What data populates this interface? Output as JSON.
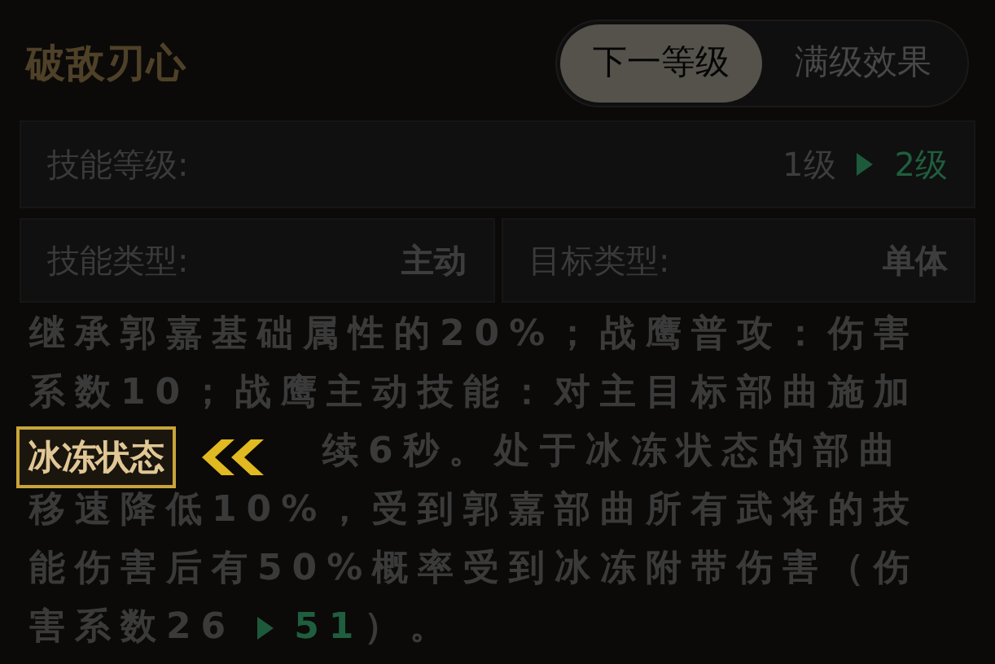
{
  "title": "破敌刃心",
  "tabs": [
    {
      "label": "下一等级",
      "selected": true
    },
    {
      "label": "满级效果",
      "selected": false
    }
  ],
  "level_row": {
    "label": "技能等级:",
    "current": "1级",
    "next": "2级"
  },
  "type_row": [
    {
      "label": "技能类型:",
      "value": "主动"
    },
    {
      "label": "目标类型:",
      "value": "单体"
    }
  ],
  "description": {
    "lines": [
      {
        "segments": [
          {
            "kind": "text",
            "text": "继承郭嘉基础属性的20%；战鹰普攻：伤害"
          }
        ]
      },
      {
        "segments": [
          {
            "kind": "text",
            "text": "系数10；战鹰主动技能：对主目标部曲施加"
          }
        ]
      },
      {
        "segments": [
          {
            "kind": "text",
            "text": "续6秒。处于冰冻状态的部曲"
          }
        ]
      },
      {
        "segments": [
          {
            "kind": "text",
            "text": "移速降低10%，受到郭嘉部曲所有武将的技"
          }
        ]
      },
      {
        "segments": [
          {
            "kind": "text",
            "text": "能伤害后有50%概率受到冰冻附带伤害（伤"
          }
        ]
      },
      {
        "segments": [
          {
            "kind": "text",
            "text": "害系数26"
          },
          {
            "kind": "arrow"
          },
          {
            "kind": "upgrade",
            "text": "51"
          },
          {
            "kind": "text",
            "text": "）。"
          }
        ]
      }
    ],
    "tag": {
      "label": "冰冻状态"
    }
  }
}
